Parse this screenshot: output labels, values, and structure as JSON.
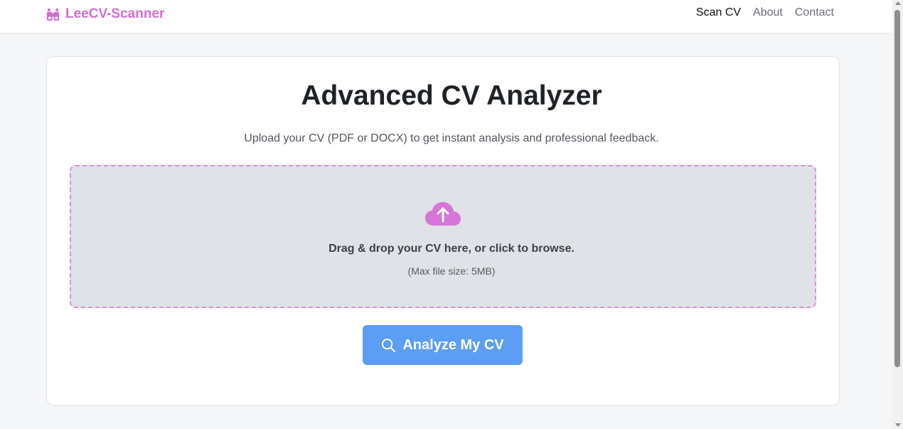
{
  "navbar": {
    "brand": "LeeCV-Scanner",
    "brand_icon": "binoculars-icon",
    "links": [
      {
        "label": "Scan CV",
        "active": true
      },
      {
        "label": "About",
        "active": false
      },
      {
        "label": "Contact",
        "active": false
      }
    ]
  },
  "main": {
    "title": "Advanced CV Analyzer",
    "subtitle": "Upload your CV (PDF or DOCX) to get instant analysis and professional feedback.",
    "dropzone": {
      "icon": "cloud-upload-icon",
      "text": "Drag & drop your CV here, or click to browse.",
      "subtext": "(Max file size: 5MB)"
    },
    "analyze_button": {
      "label": "Analyze My CV",
      "icon": "search-icon"
    }
  },
  "colors": {
    "brand": "#cf6fd0",
    "button": "#5b9ef3",
    "dropzone_border": "#e08ce0",
    "dropzone_bg": "#dfe2e6"
  }
}
